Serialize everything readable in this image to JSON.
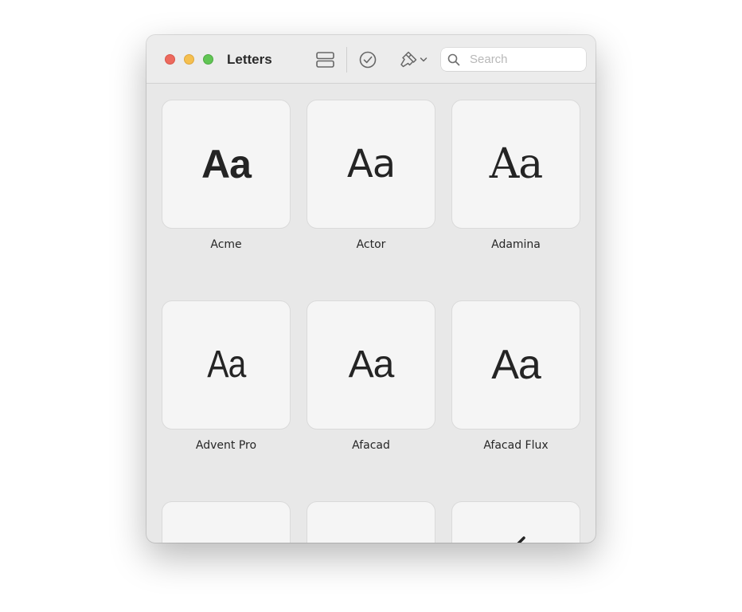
{
  "window": {
    "title": "Letters"
  },
  "search": {
    "placeholder": "Search",
    "value": ""
  },
  "toolbar": {
    "layout_icon": "list-layout-icon",
    "check_icon": "checkmark-circle-icon",
    "brush_icon": "paintbrush-icon",
    "chevron_icon": "chevron-down-icon",
    "search_icon": "magnifier-icon"
  },
  "fonts": [
    {
      "sample": "Aa",
      "name": "Acme"
    },
    {
      "sample": "Aa",
      "name": "Actor"
    },
    {
      "sample": "Aa",
      "name": "Adamina"
    },
    {
      "sample": "Aa",
      "name": "Advent Pro"
    },
    {
      "sample": "Aa",
      "name": "Afacad"
    },
    {
      "sample": "Aa",
      "name": "Afacad Flux"
    }
  ],
  "colors": {
    "close": "#ed6a5e",
    "minimize": "#f5bf4f",
    "maximize": "#61c554"
  }
}
